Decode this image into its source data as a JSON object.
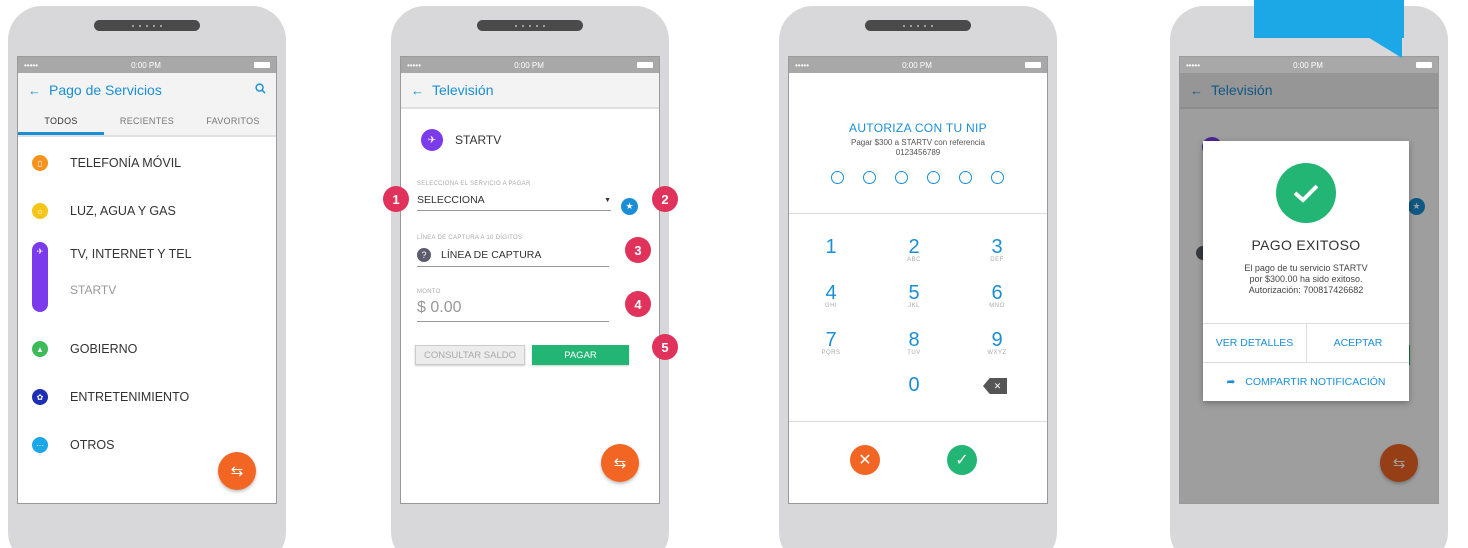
{
  "colors": {
    "accent": "#1a8fd6",
    "fab": "#f26522",
    "success": "#22b573",
    "badge": "#e0325a"
  },
  "status_time": "0:00 PM",
  "status_signal": "•••••",
  "screen1": {
    "title": "Pago de Servicios",
    "tabs": [
      "TODOS",
      "RECIENTES",
      "FAVORITOS"
    ],
    "categories": [
      {
        "label": "TELEFONÍA MÓVIL",
        "icon": "phone-icon",
        "color": "#f7941d"
      },
      {
        "label": "LUZ, AGUA Y GAS",
        "icon": "home-icon",
        "color": "#f5c518"
      },
      {
        "label": "TV, INTERNET Y TEL",
        "icon": "satellite-icon",
        "color": "#7c3aed",
        "sub": "STARTV"
      },
      {
        "label": "GOBIERNO",
        "icon": "building-icon",
        "color": "#3dbb5a"
      },
      {
        "label": "ENTRETENIMIENTO",
        "icon": "entertainment-icon",
        "color": "#1e2fb5"
      },
      {
        "label": "OTROS",
        "icon": "more-icon",
        "color": "#1ca7e6"
      }
    ]
  },
  "screen2": {
    "title": "Televisión",
    "provider": "STARTV",
    "service_label": "SELECCIONA EL SERVICIO A PAGAR",
    "service_value": "SELECCIONA",
    "capture_label": "LÍNEA DE CAPTURA A 10 DÍGITOS",
    "capture_placeholder": "LÍNEA DE CAPTURA",
    "amount_label": "MONTO",
    "amount_placeholder": "$ 0.00",
    "balance_button": "CONSULTAR SALDO",
    "pay_button": "PAGAR",
    "badges": [
      "1",
      "2",
      "3",
      "4",
      "5"
    ]
  },
  "screen3": {
    "title": "AUTORIZA CON TU NIP",
    "subtitle_1": "Pagar $300 a STARTV con referencia",
    "subtitle_2": "0123456789",
    "keys": [
      {
        "n": "1",
        "s": ""
      },
      {
        "n": "2",
        "s": "ABC"
      },
      {
        "n": "3",
        "s": "DEF"
      },
      {
        "n": "4",
        "s": "GHI"
      },
      {
        "n": "5",
        "s": "JKL"
      },
      {
        "n": "6",
        "s": "MNO"
      },
      {
        "n": "7",
        "s": "PQRS"
      },
      {
        "n": "8",
        "s": "TUV"
      },
      {
        "n": "9",
        "s": "WXYZ"
      },
      {
        "n": "0",
        "s": ""
      }
    ]
  },
  "screen4": {
    "title": "Televisión",
    "modal_title": "PAGO EXITOSO",
    "modal_line1": "El pago de tu servicio STARTV",
    "modal_line2": "por $300.00 ha sido exitoso.",
    "modal_line3": "Autorización: 700817426682",
    "details_button": "VER DETALLES",
    "accept_button": "ACEPTAR",
    "share_button": "COMPARTIR NOTIFICACIÓN"
  }
}
